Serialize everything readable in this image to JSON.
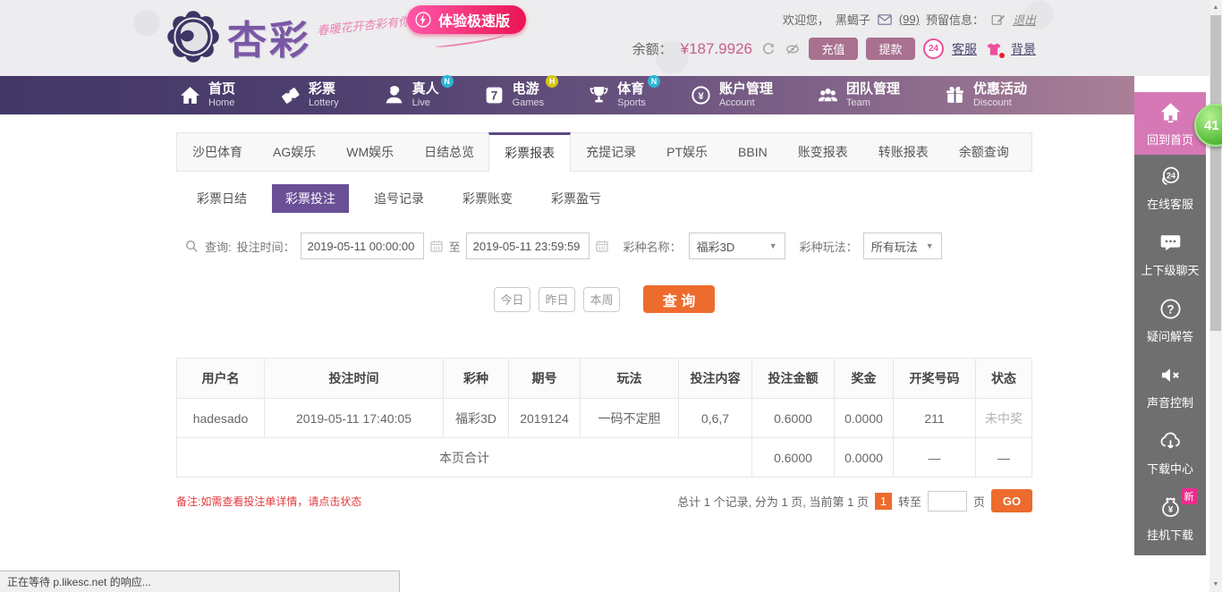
{
  "header": {
    "logo_text": "杏彩",
    "logo_tagline": "春暖花开杏彩有你!",
    "speed_button": "体验极速版",
    "welcome": "欢迎您，",
    "username": "黑蝎子",
    "mail_count": "(99)",
    "reserved_label": "预留信息：",
    "logout": "退出",
    "balance_label": "余额：",
    "balance_value": "¥187.9926",
    "recharge": "充值",
    "withdraw": "提款",
    "service_24": "24",
    "service": "客服",
    "background": "背景"
  },
  "nav": {
    "items": [
      {
        "zh": "首页",
        "en": "Home",
        "badge": ""
      },
      {
        "zh": "彩票",
        "en": "Lottery",
        "badge": ""
      },
      {
        "zh": "真人",
        "en": "Live",
        "badge": "N"
      },
      {
        "zh": "电游",
        "en": "Games",
        "badge": "H"
      },
      {
        "zh": "体育",
        "en": "Sports",
        "badge": "N"
      },
      {
        "zh": "账户管理",
        "en": "Account",
        "badge": ""
      },
      {
        "zh": "团队管理",
        "en": "Team",
        "badge": ""
      },
      {
        "zh": "优惠活动",
        "en": "Discount",
        "badge": ""
      }
    ]
  },
  "tabs_report": {
    "items": [
      "沙巴体育",
      "AG娱乐",
      "WM娱乐",
      "日结总览",
      "彩票报表",
      "充提记录",
      "PT娱乐",
      "BBIN",
      "账变报表",
      "转账报表",
      "余额查询"
    ],
    "active_index": 4
  },
  "tabs_lottery": {
    "items": [
      "彩票日结",
      "彩票投注",
      "追号记录",
      "彩票账变",
      "彩票盈亏"
    ],
    "active_index": 1
  },
  "query": {
    "search_label": "查询:",
    "bet_time_label": "投注时间：",
    "date_from": "2019-05-11 00:00:00",
    "to_label": "至",
    "date_to": "2019-05-11 23:59:59",
    "lottery_label": "彩种名称：",
    "lottery_value": "福彩3D",
    "play_label": "彩种玩法：",
    "play_value": "所有玩法",
    "today": "今日",
    "yesterday": "昨日",
    "week": "本周",
    "submit": "查 询"
  },
  "table": {
    "headers": [
      "用户名",
      "投注时间",
      "彩种",
      "期号",
      "玩法",
      "投注内容",
      "投注金额",
      "奖金",
      "开奖号码",
      "状态"
    ],
    "rows": [
      [
        "hadesado",
        "2019-05-11 17:40:05",
        "福彩3D",
        "2019124",
        "一码不定胆",
        "0,6,7",
        "0.6000",
        "0.0000",
        "211",
        "未中奖"
      ]
    ],
    "summary": [
      "本页合计",
      "0.6000",
      "0.0000",
      "—",
      "—"
    ]
  },
  "footer": {
    "note": "备注:如需查看投注单详情，请点击状态",
    "total_text": "总计 1 个记录, 分为 1 页, 当前第 1 页",
    "current_page": "1",
    "goto_label": "转至",
    "page_label": "页",
    "go_label": "GO"
  },
  "sidebar": {
    "notification_count": "41",
    "items": [
      {
        "label": "回到首页",
        "badge": ""
      },
      {
        "label": "在线客服",
        "badge": ""
      },
      {
        "label": "上下级聊天",
        "badge": ""
      },
      {
        "label": "疑问解答",
        "badge": ""
      },
      {
        "label": "声音控制",
        "badge": ""
      },
      {
        "label": "下载中心",
        "badge": ""
      },
      {
        "label": "挂机下载",
        "badge": "新"
      }
    ]
  },
  "statusbar": {
    "text": "正在等待 p.likesc.net 的响应..."
  },
  "icons": {
    "select_arrow": "▼",
    "scroll_up": "▲",
    "scroll_down": "▼",
    "games_glyph": "7",
    "account_glyph": "¥",
    "service24_glyph": "24",
    "question_glyph": "?",
    "pouch_glyph": "¥"
  },
  "colors": {
    "nav_gradient_left": "#443868",
    "nav_gradient_right": "#aa8097",
    "active_subtab_purple": "#6b4f97",
    "accent_orange": "#ed6c2d",
    "accent_pink": "#ec4f9d",
    "balance_pink": "#c75f88",
    "sidebar_gray": "#6f6f6f",
    "sidebar_pink": "#d778b6",
    "note_red": "#e4393c",
    "badge_green": "#58be3b"
  }
}
